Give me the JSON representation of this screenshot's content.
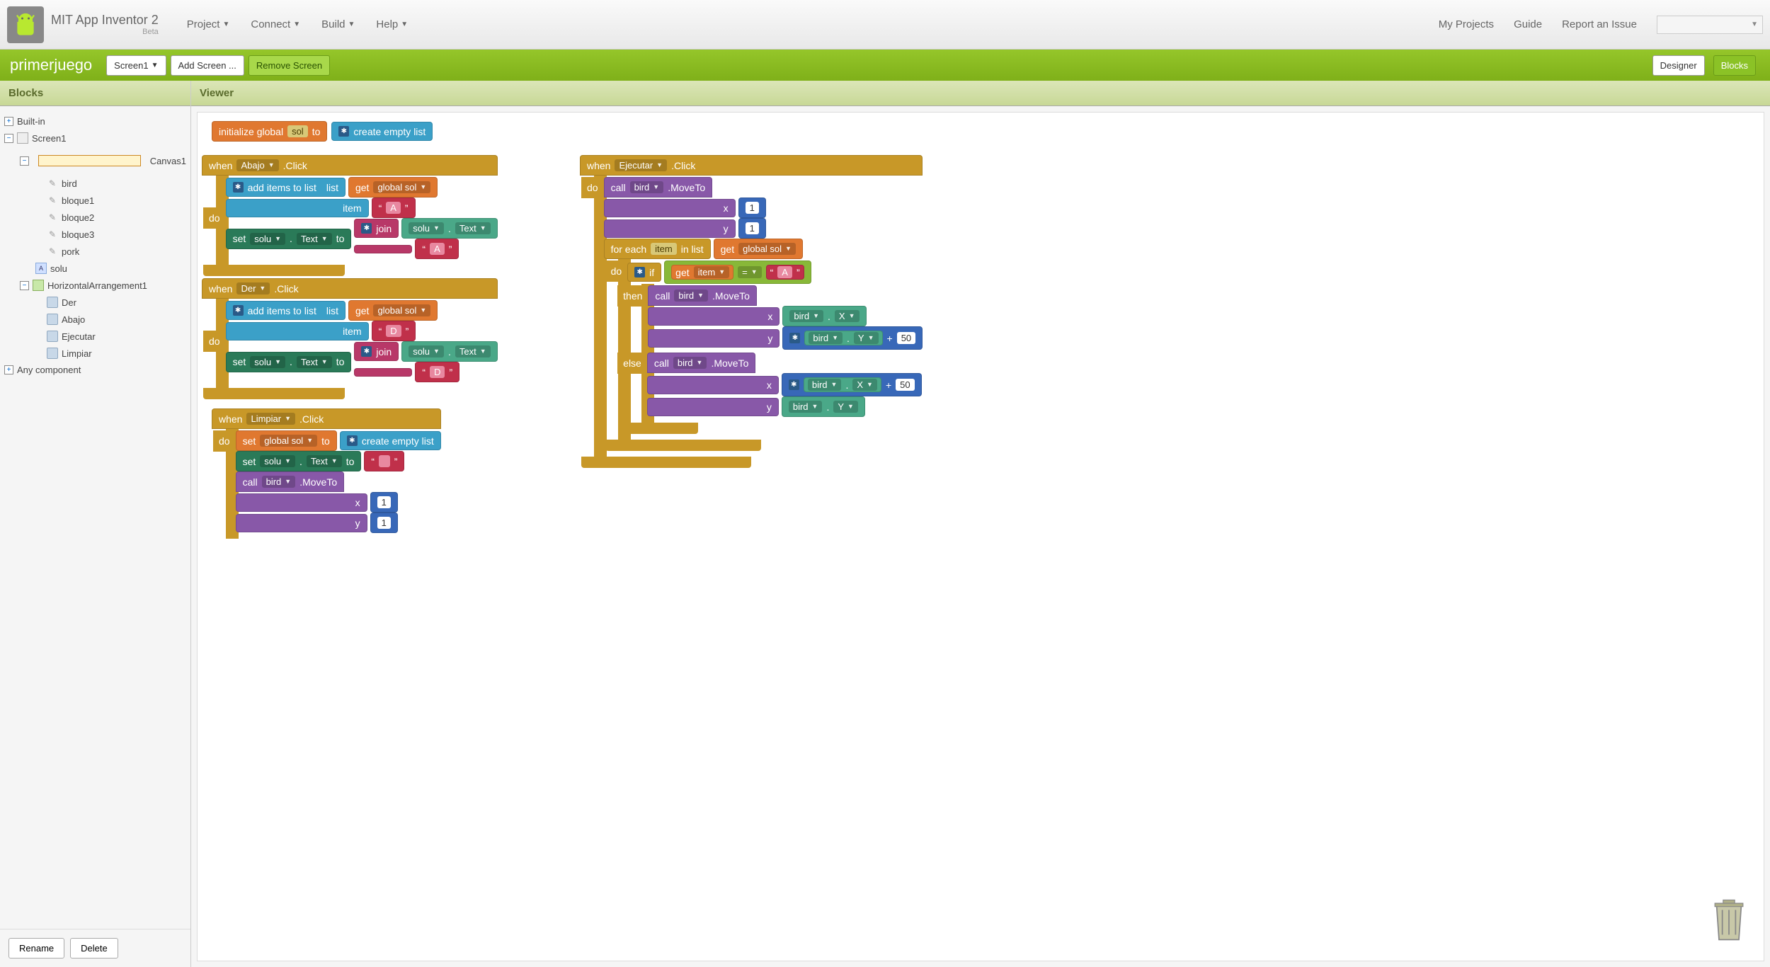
{
  "header": {
    "title": "MIT App Inventor 2",
    "beta": "Beta",
    "menu": {
      "project": "Project",
      "connect": "Connect",
      "build": "Build",
      "help": "Help"
    },
    "right": {
      "myprojects": "My Projects",
      "guide": "Guide",
      "report": "Report an Issue"
    }
  },
  "greenbar": {
    "project": "primerjuego",
    "screen": "Screen1",
    "addscreen": "Add Screen ...",
    "removescreen": "Remove Screen",
    "designer": "Designer",
    "blocks": "Blocks"
  },
  "panels": {
    "blocks": "Blocks",
    "viewer": "Viewer"
  },
  "tree": {
    "builtin": "Built-in",
    "screen1": "Screen1",
    "canvas1": "Canvas1",
    "sprites": [
      "bird",
      "bloque1",
      "bloque2",
      "bloque3",
      "pork"
    ],
    "solu": "solu",
    "harr": "HorizontalArrangement1",
    "buttons": [
      "Der",
      "Abajo",
      "Ejecutar",
      "Limpiar"
    ],
    "anycomp": "Any component"
  },
  "buttons": {
    "rename": "Rename",
    "delete": "Delete"
  },
  "blocks": {
    "init_global": "initialize global",
    "sol": "sol",
    "to": "to",
    "create_empty_list": "create empty list",
    "when": "when",
    "click": ".Click",
    "do": "do",
    "add_items": "add items to list",
    "list": "list",
    "item": "item",
    "get": "get",
    "global_sol": "global sol",
    "set": "set",
    "solu": "solu",
    "text_prop": "Text",
    "join": "join",
    "letter_a": "A",
    "letter_d": "D",
    "quote": "“",
    "quote2": "”",
    "call": "call",
    "bird": "bird",
    "moveto": ".MoveTo",
    "x": "x",
    "y": "y",
    "one": "1",
    "for_each": "for each",
    "in_list": "in list",
    "if": "if",
    "then": "then",
    "else": "else",
    "eq": "=",
    "item_v": "item",
    "X": "X",
    "Y": "Y",
    "plus": "+",
    "fifty": "50",
    "abajo": "Abajo",
    "der": "Der",
    "limpiar": "Limpiar",
    "ejecutar": "Ejecutar",
    "empty": " "
  }
}
